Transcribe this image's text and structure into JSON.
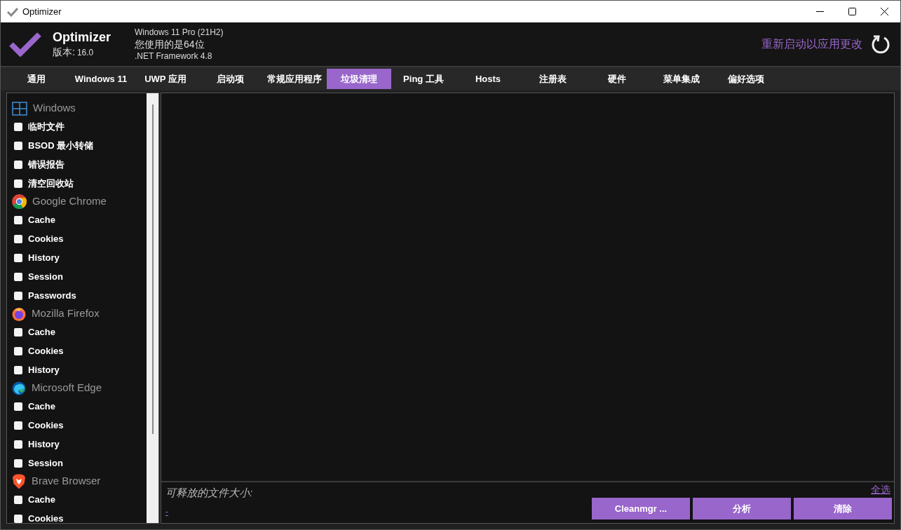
{
  "window": {
    "title": "Optimizer"
  },
  "header": {
    "app_name": "Optimizer",
    "version_label": "版本:",
    "version": "16.0",
    "os": "Windows 11 Pro (21H2)",
    "bits": "您使用的是64位",
    "framework": ".NET Framework 4.8",
    "restart": "重新启动以应用更改"
  },
  "tabs": [
    {
      "label": "通用",
      "selected": false
    },
    {
      "label": "Windows 11",
      "selected": false
    },
    {
      "label": "UWP 应用",
      "selected": false
    },
    {
      "label": "启动项",
      "selected": false
    },
    {
      "label": "常规应用程序",
      "selected": false
    },
    {
      "label": "垃圾清理",
      "selected": true
    },
    {
      "label": "Ping 工具",
      "selected": false
    },
    {
      "label": "Hosts",
      "selected": false
    },
    {
      "label": "注册表",
      "selected": false
    },
    {
      "label": "硬件",
      "selected": false
    },
    {
      "label": "菜单集成",
      "selected": false
    },
    {
      "label": "偏好选项",
      "selected": false
    }
  ],
  "sidebar": {
    "groups": [
      {
        "kind": "windows",
        "title": "Windows",
        "items": [
          {
            "label": "临时文件",
            "checked": false
          },
          {
            "label": "BSOD 最小转储",
            "checked": false
          },
          {
            "label": "错误报告",
            "checked": false
          },
          {
            "label": "清空回收站",
            "checked": false
          }
        ]
      },
      {
        "kind": "chrome",
        "title": "Google Chrome",
        "items": [
          {
            "label": "Cache",
            "checked": false
          },
          {
            "label": "Cookies",
            "checked": false
          },
          {
            "label": "History",
            "checked": false
          },
          {
            "label": "Session",
            "checked": false
          },
          {
            "label": "Passwords",
            "checked": false
          }
        ]
      },
      {
        "kind": "firefox",
        "title": "Mozilla Firefox",
        "items": [
          {
            "label": "Cache",
            "checked": false
          },
          {
            "label": "Cookies",
            "checked": false
          },
          {
            "label": "History",
            "checked": false
          }
        ]
      },
      {
        "kind": "edge",
        "title": "Microsoft Edge",
        "items": [
          {
            "label": "Cache",
            "checked": false
          },
          {
            "label": "Cookies",
            "checked": false
          },
          {
            "label": "History",
            "checked": false
          },
          {
            "label": "Session",
            "checked": false
          }
        ]
      },
      {
        "kind": "brave",
        "title": "Brave Browser",
        "items": [
          {
            "label": "Cache",
            "checked": false
          },
          {
            "label": "Cookies",
            "checked": false
          }
        ]
      }
    ]
  },
  "footer": {
    "size_label": "可释放的文件大小:",
    "size_link": "-",
    "select_all": "全选",
    "buttons": [
      "Cleanmgr ...",
      "分析",
      "清除"
    ]
  }
}
